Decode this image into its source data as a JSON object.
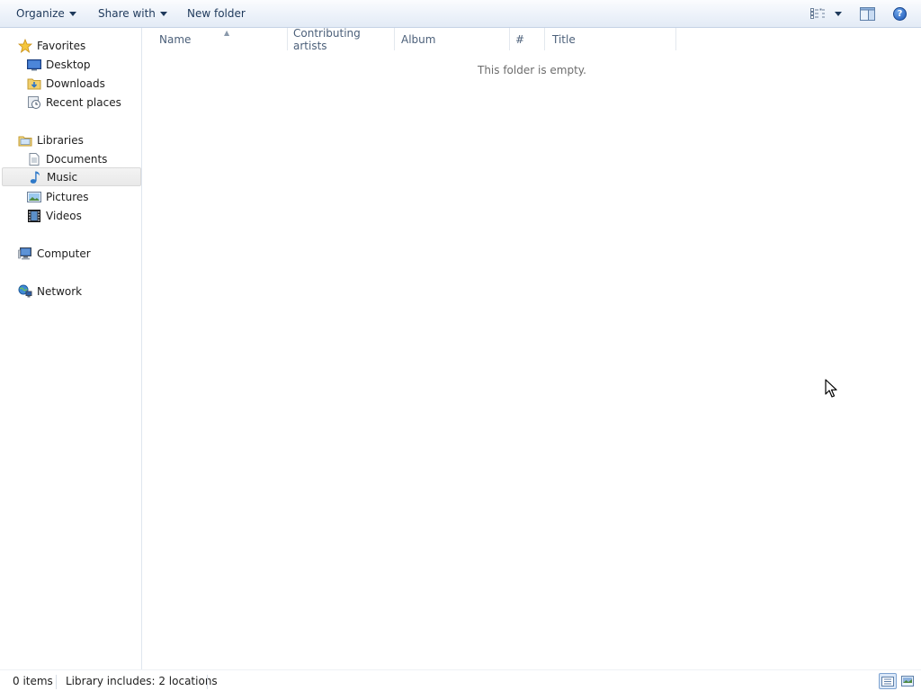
{
  "toolbar": {
    "organize_label": "Organize",
    "share_label": "Share with",
    "new_folder_label": "New folder"
  },
  "nav": {
    "favorites": {
      "label": "Favorites",
      "icon": "star-icon"
    },
    "favorites_items": [
      {
        "label": "Desktop",
        "icon": "desktop-icon"
      },
      {
        "label": "Downloads",
        "icon": "downloads-folder-icon"
      },
      {
        "label": "Recent places",
        "icon": "recent-places-icon"
      }
    ],
    "libraries": {
      "label": "Libraries",
      "icon": "libraries-icon"
    },
    "libraries_items": [
      {
        "label": "Documents",
        "icon": "document-icon"
      },
      {
        "label": "Music",
        "icon": "music-note-icon",
        "selected": true
      },
      {
        "label": "Pictures",
        "icon": "picture-icon"
      },
      {
        "label": "Videos",
        "icon": "film-icon"
      }
    ],
    "computer": {
      "label": "Computer",
      "icon": "computer-icon"
    },
    "network": {
      "label": "Network",
      "icon": "network-icon"
    }
  },
  "content": {
    "columns": [
      "Name",
      "Contributing artists",
      "Album",
      "#",
      "Title"
    ],
    "sorted_column": "Name",
    "empty_message": "This folder is empty."
  },
  "status": {
    "item_count": "0 items",
    "library_info": "Library includes: 2 locations"
  },
  "colors": {
    "toolbar_text": "#1e395b",
    "selection_bg": "#e9e9e9",
    "header_text": "#4c607a",
    "empty_text": "#6d6d6d"
  }
}
